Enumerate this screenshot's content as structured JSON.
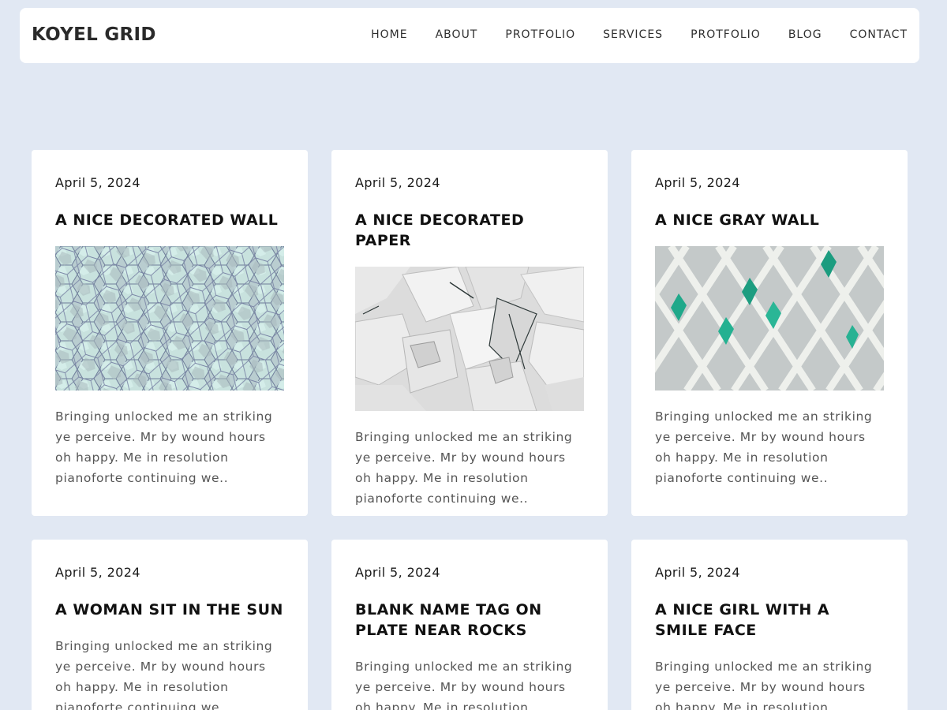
{
  "header": {
    "brand": "KOYEL GRID",
    "nav": [
      {
        "label": "HOME"
      },
      {
        "label": "ABOUT"
      },
      {
        "label": "PROTFOLIO"
      },
      {
        "label": "SERVICES"
      },
      {
        "label": "PROTFOLIO"
      },
      {
        "label": "BLOG"
      },
      {
        "label": "CONTACT"
      }
    ]
  },
  "colors": {
    "background": "#e1e8f3",
    "card": "#ffffff",
    "text_heading": "#111111",
    "text_body": "#555555"
  },
  "posts": [
    {
      "date": "April 5, 2024",
      "title": "A NICE DECORATED WALL",
      "image": "decorated-wall-image",
      "excerpt": "Bringing unlocked me an striking ye perceive. Mr by wound hours oh happy. Me in resolution pianoforte continuing we.."
    },
    {
      "date": "April 5, 2024",
      "title": "A NICE DECORATED PAPER",
      "image": "decorated-paper-image",
      "excerpt": "Bringing unlocked me an striking ye perceive. Mr by wound hours oh happy. Me in resolution pianoforte continuing we.."
    },
    {
      "date": "April 5, 2024",
      "title": "A NICE GRAY WALL",
      "image": "gray-wall-image",
      "excerpt": "Bringing unlocked me an striking ye perceive. Mr by wound hours oh happy. Me in resolution pianoforte continuing we.."
    },
    {
      "date": "April 5, 2024",
      "title": "A WOMAN SIT IN THE SUN",
      "excerpt": "Bringing unlocked me an striking ye perceive. Mr by wound hours oh happy. Me in resolution pianoforte continuing we.."
    },
    {
      "date": "April 5, 2024",
      "title": "BLANK NAME TAG ON PLATE NEAR ROCKS",
      "excerpt": "Bringing unlocked me an striking ye perceive. Mr by wound hours oh happy. Me in resolution pianoforte continuing we.."
    },
    {
      "date": "April 5, 2024",
      "title": "A NICE GIRL WITH A SMILE FACE",
      "excerpt": "Bringing unlocked me an striking ye perceive. Mr by wound hours oh happy. Me in resolution pianoforte continuing we.."
    }
  ]
}
